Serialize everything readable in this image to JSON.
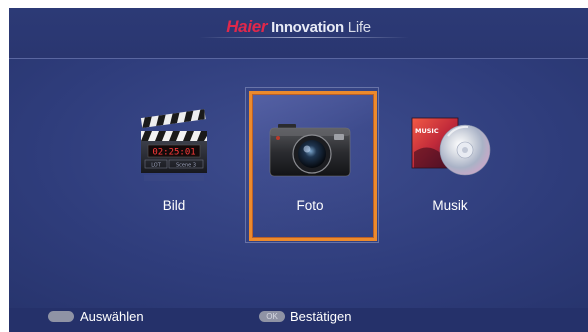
{
  "header": {
    "brand": "Haier",
    "tagline_bold": "Innovation",
    "tagline_light": "Life"
  },
  "menu": {
    "items": [
      {
        "label": "Bild",
        "icon": "clapperboard-icon",
        "selected": false,
        "clapper_time": "02:25:01",
        "clapper_cells": [
          "LOT",
          "Scene 3"
        ]
      },
      {
        "label": "Foto",
        "icon": "camera-icon",
        "selected": true
      },
      {
        "label": "Musik",
        "icon": "music-cd-icon",
        "selected": false,
        "cover_text": "MUSIC"
      }
    ]
  },
  "footer": {
    "hints": [
      {
        "label": "Auswählen",
        "icon": "dpad-icon",
        "icon_text": ""
      },
      {
        "label": "Bestätigen",
        "icon": "ok-button-icon",
        "icon_text": "OK"
      }
    ]
  },
  "colors": {
    "background": "#2f3d7c",
    "selection": "#ec8a2c",
    "brand": "#e0284b"
  }
}
